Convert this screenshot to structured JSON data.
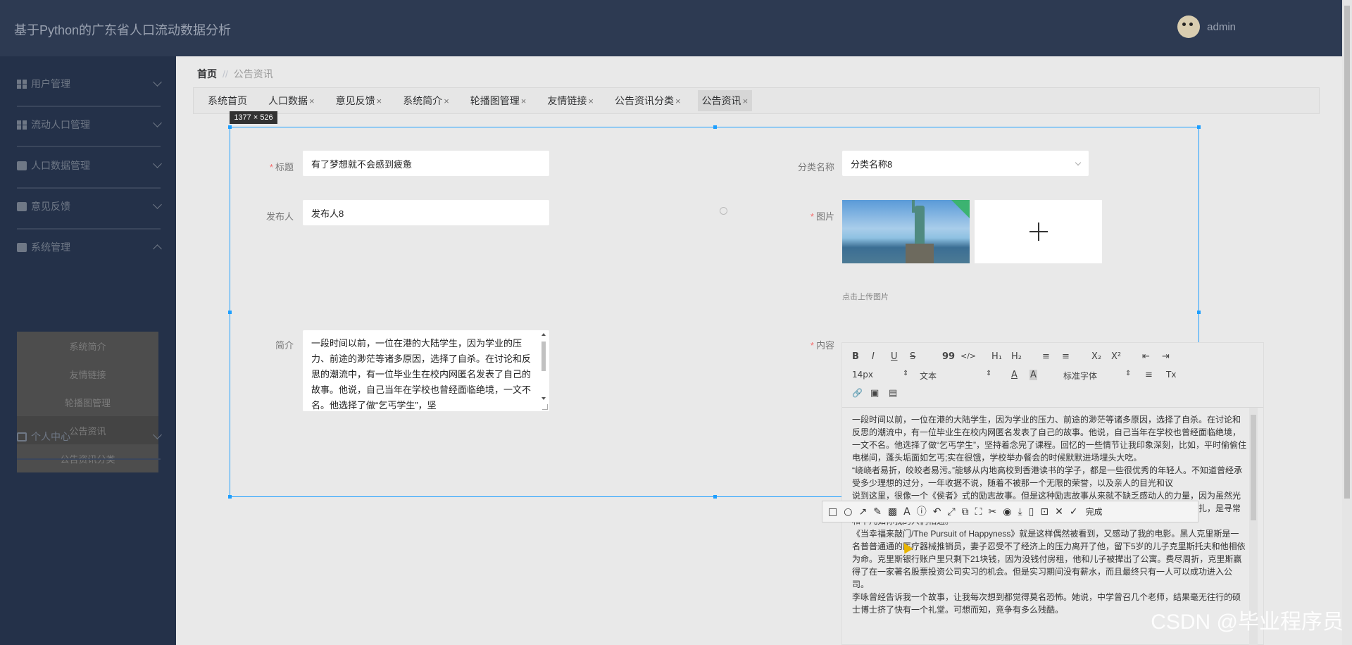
{
  "header": {
    "app_title": "基于Python的广东省人口流动数据分析",
    "username": "admin"
  },
  "sidebar": {
    "menus": [
      {
        "label": "用户管理"
      },
      {
        "label": "流动人口管理"
      },
      {
        "label": "人口数据管理"
      },
      {
        "label": "意见反馈"
      },
      {
        "label": "系统管理"
      },
      {
        "label": "个人中心"
      }
    ],
    "submenu": [
      "系统简介",
      "友情链接",
      "轮播图管理",
      "公告资讯",
      "公告资讯分类"
    ],
    "submenu_active": "公告资讯"
  },
  "breadcrumb": {
    "home": "首页",
    "separator": "//",
    "current": "公告资讯"
  },
  "tags": [
    {
      "label": "系统首页",
      "closable": false
    },
    {
      "label": "人口数据",
      "closable": true
    },
    {
      "label": "意见反馈",
      "closable": true
    },
    {
      "label": "系统简介",
      "closable": true
    },
    {
      "label": "轮播图管理",
      "closable": true
    },
    {
      "label": "友情链接",
      "closable": true
    },
    {
      "label": "公告资讯分类",
      "closable": true
    },
    {
      "label": "公告资讯",
      "closable": true
    }
  ],
  "tag_close": "×",
  "screenshot_overlay": {
    "size_label": "1377 × 526"
  },
  "form": {
    "title_label": "标题",
    "title_value": "有了梦想就不会感到疲惫",
    "category_label": "分类名称",
    "category_value": "分类名称8",
    "publisher_label": "发布人",
    "publisher_value": "发布人8",
    "image_label": "图片",
    "upload_hint": "点击上传图片",
    "summary_label": "简介",
    "summary_value": "一段时间以前，一位在港的大陆学生，因为学业的压力、前途的渺茫等诸多原因，选择了自杀。在讨论和反思的潮流中，有一位毕业生在校内网匿名发表了自己的故事。他说，自己当年在学校也曾经面临绝境，一文不名。他选择了做“乞丐学生”，坚",
    "content_label": "内容",
    "required_mark": "*"
  },
  "editor": {
    "toolbar": {
      "bold": "B",
      "italic": "I",
      "underline": "U",
      "strike": "S",
      "quote": "99",
      "code": "</>",
      "h1": "H₁",
      "h2": "H₂",
      "ol": "≡",
      "ul": "≡",
      "sub": "X₂",
      "sup": "X²",
      "outdent": "⇤",
      "indent": "⇥",
      "size": "14px",
      "header": "文本",
      "color": "A",
      "bg": "A",
      "font": "标准字体",
      "align": "≡",
      "clean": "Tx",
      "link": "🔗",
      "image": "▣",
      "video": "▤"
    },
    "content": [
      "一段时间以前，一位在港的大陆学生，因为学业的压力、前途的渺茫等诸多原因，选择了自杀。在讨论和反思的潮流中，有一位毕业生在校内网匿名发表了自己的故事。他说，自己当年在学校也曾经面临绝境，一文不名。他选择了做“乞丐学生”，坚持着念完了课程。回忆的一些情节让我印象深刻，比如，平时偷偷住电梯间，蓬头垢面如乞丐;实在很饿，学校举办餐会的时候默默进场埋头大吃。",
      "“峣峣者易折，皎皎者易污。”能够从内地高校到香港读书的学子，都是一些很优秀的年轻人。不知道曾经承受多少理想的过分，一年收据不说，随着不被那一个无限的荣誉，以及亲人的目光和议",
      "说到这里，很像一个《侯者》式的励志故事。但是这种励志故事从来就不缺乏感动人的力量，因为虽然光明的尾巴不是人人都能够拥有，但是人人都有梦想，面对实现过程中的困难，其奋斗或者说挣扎，是寻常和平凡如你我的人们相通。",
      "《当幸福来敲门/The Pursuit of Happyness》就是这样偶然被看到，又感动了我的电影。黑人克里斯是一名普普通通的医疗器械推销员，妻子忍受不了经济上的压力离开了他，留下5岁的儿子克里斯托夫和他相依为命。克里斯银行账户里只剩下21块钱，因为没钱付房租，他和儿子被撵出了公寓。费尽周折，克里斯赢得了在一家著名股票投资公司实习的机会。但是实习期间没有薪水，而且最终只有一人可以成功进入公司。",
      "李咏曾经告诉我一个故事，让我每次想到都觉得莫名恐怖。她说，中学曾召几个老师，结果毫无往行的硕士博士挤了快有一个礼堂。可想而知，竞争有多么残酷。"
    ]
  },
  "snip_toolbar": {
    "icons": [
      "□",
      "○",
      "↗",
      "✎",
      "▩",
      "A",
      "ⓘ",
      "↶",
      "⤢",
      "⧉",
      "⛶",
      "✂",
      "◉",
      "⤓",
      "▯",
      "⊡",
      "✕",
      "✓"
    ],
    "done_label": "完成"
  },
  "watermark": "CSDN @毕业程序员",
  "colors": {
    "header_bg": "#2d3a52",
    "sidebar_bg": "#243149",
    "accent": "#1e9fff",
    "required": "#f56c6c"
  }
}
